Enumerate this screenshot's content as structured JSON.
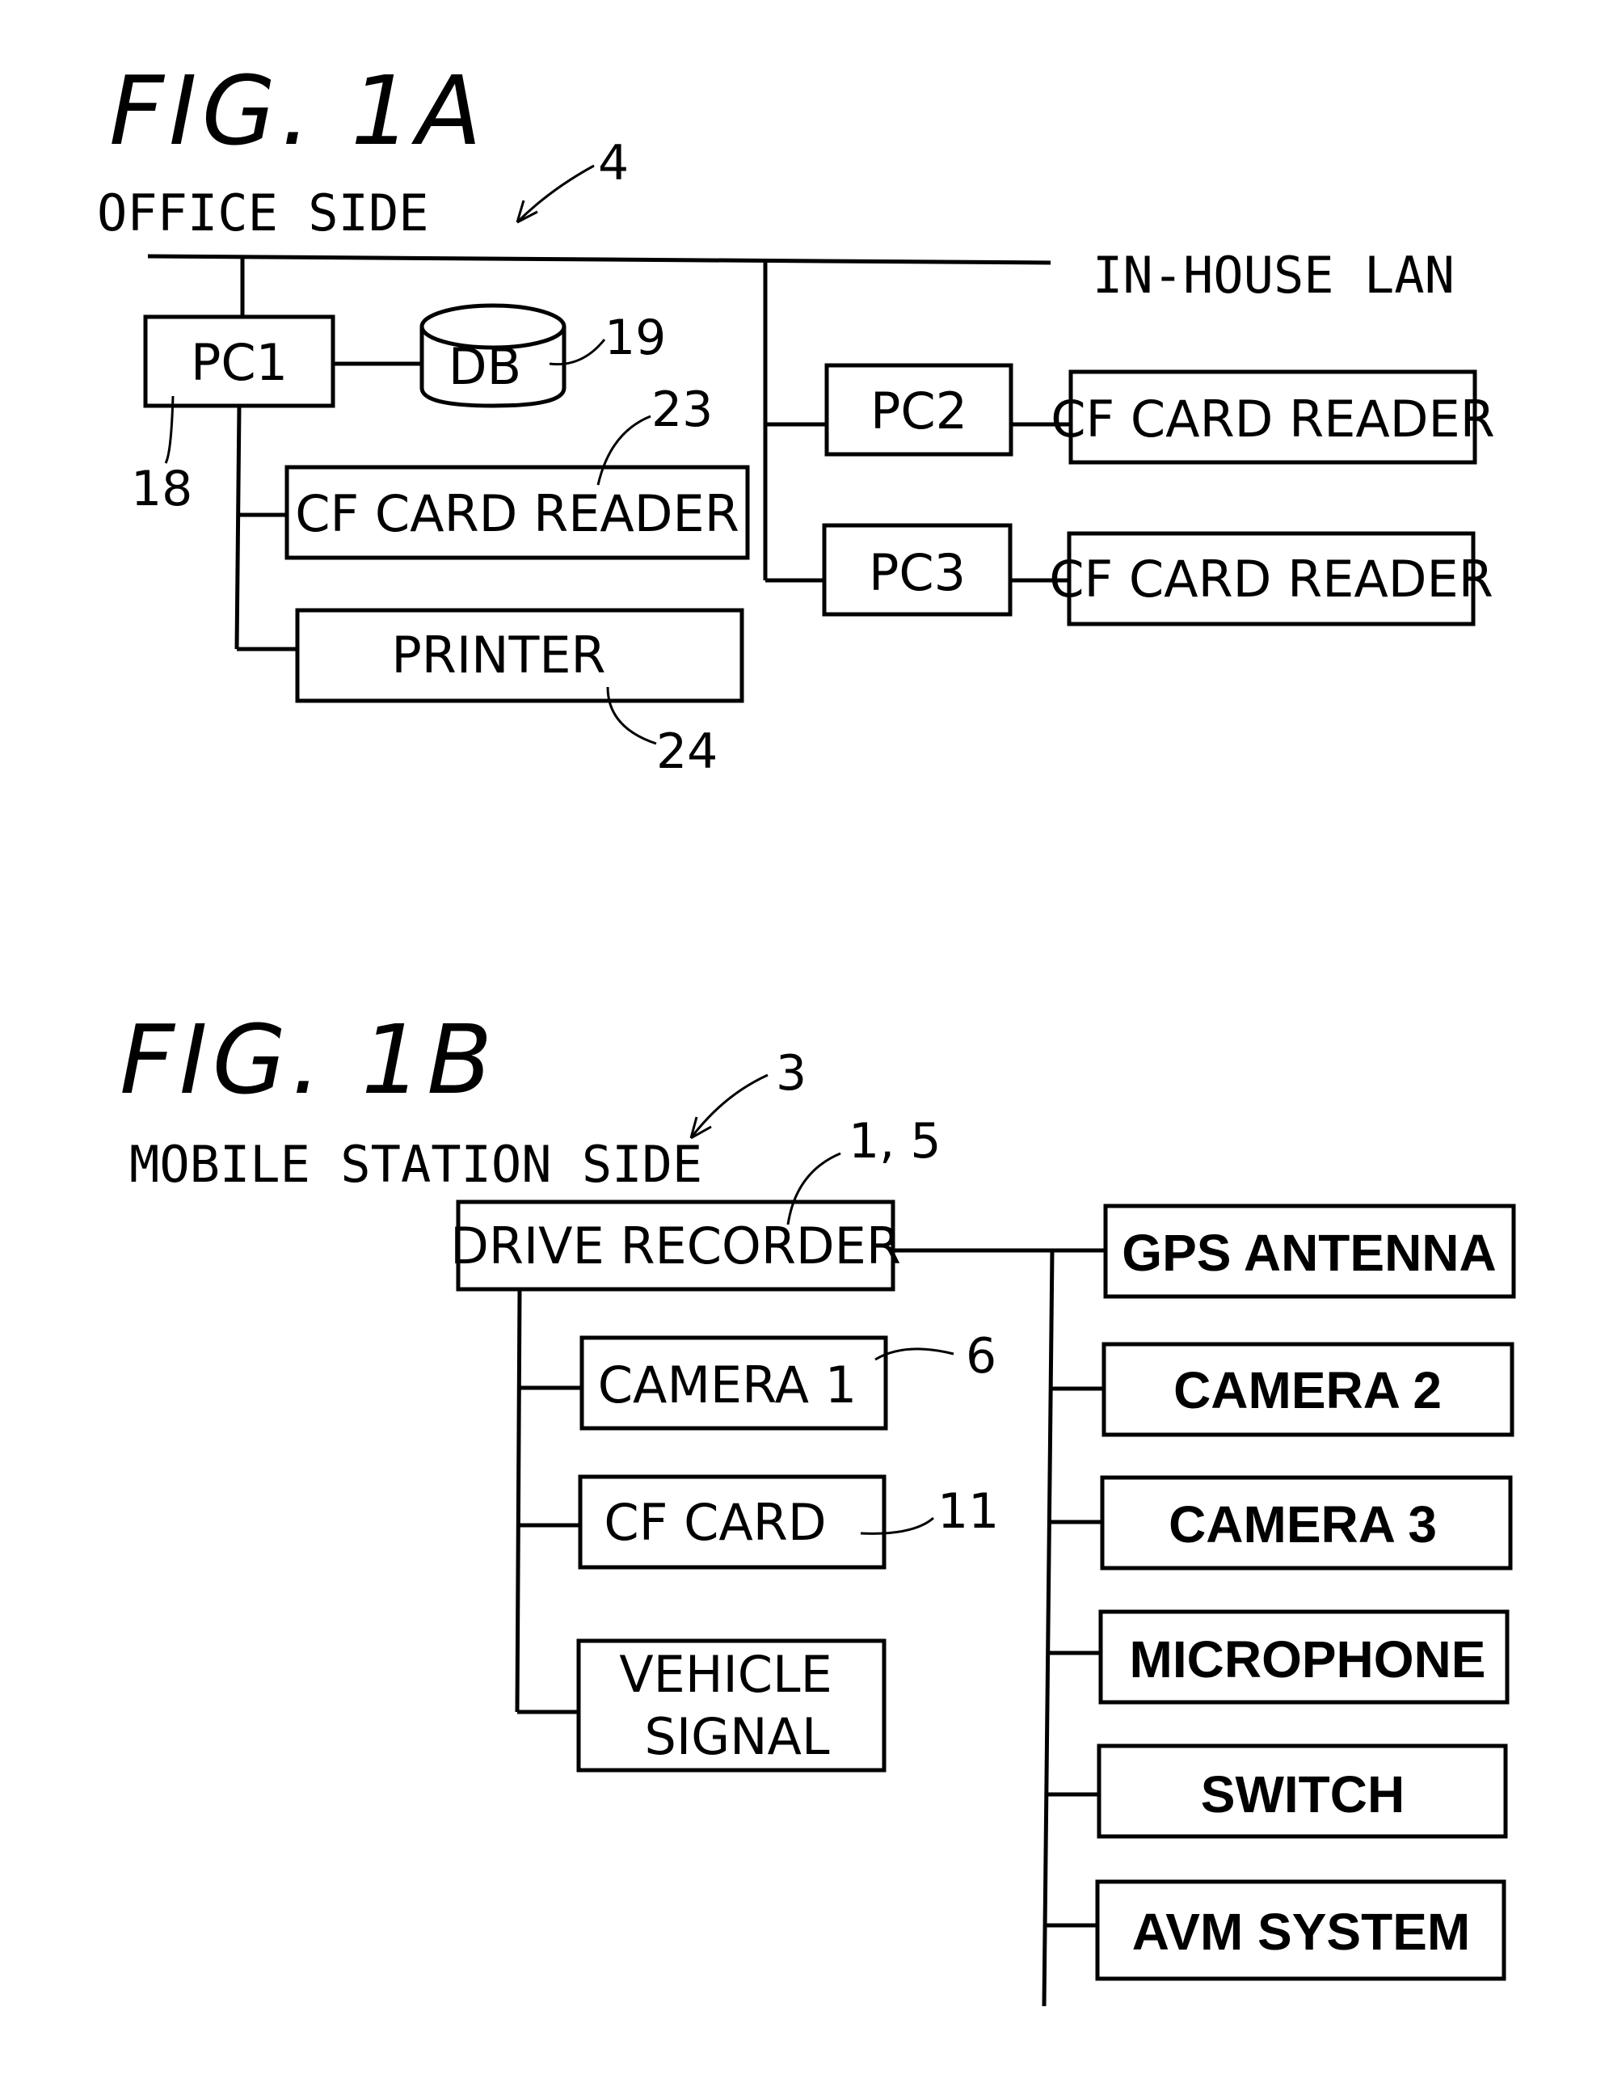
{
  "fig1a": {
    "title": "FIG. 1A",
    "side_label": "OFFICE SIDE",
    "side_ref": "4",
    "lan_label": "IN-HOUSE LAN",
    "nodes": {
      "pc1": {
        "label": "PC1",
        "ref": "18"
      },
      "db": {
        "label": "DB",
        "ref": "19"
      },
      "cf_reader_1": {
        "label": "CF CARD READER",
        "ref": "23"
      },
      "printer": {
        "label": "PRINTER",
        "ref": "24"
      },
      "pc2": {
        "label": "PC2"
      },
      "cf_reader_2": {
        "label": "CF CARD READER"
      },
      "pc3": {
        "label": "PC3"
      },
      "cf_reader_3": {
        "label": "CF CARD READER"
      }
    }
  },
  "fig1b": {
    "title": "FIG. 1B",
    "side_label": "MOBILE STATION SIDE",
    "side_ref": "3",
    "nodes": {
      "drive_recorder": {
        "label": "DRIVE RECORDER",
        "ref": "1, 5"
      },
      "camera1": {
        "label": "CAMERA 1",
        "ref": "6"
      },
      "cf_card": {
        "label": "CF CARD",
        "ref": "11"
      },
      "vehicle_signal": {
        "label_line1": "VEHICLE",
        "label_line2": "SIGNAL"
      },
      "gps_antenna": {
        "label": "GPS ANTENNA"
      },
      "camera2": {
        "label": "CAMERA 2"
      },
      "camera3": {
        "label": "CAMERA 3"
      },
      "microphone": {
        "label": "MICROPHONE"
      },
      "switch": {
        "label": "SWITCH"
      },
      "avm_system": {
        "label": "AVM SYSTEM"
      }
    }
  }
}
